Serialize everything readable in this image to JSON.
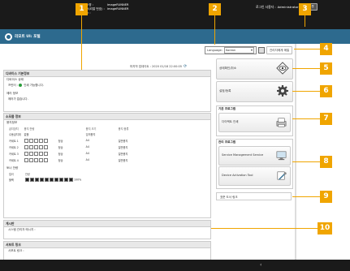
{
  "device_info": {
    "rows": [
      {
        "key": "디바이스명 :",
        "value": "imageRUNNER"
      },
      {
        "key": "제품명(시리얼 번호) :",
        "value": "imageRUNNER"
      },
      {
        "key": "설치장소 :",
        "value": ""
      }
    ]
  },
  "login": {
    "label": "로그인 사용자 :",
    "user": "Administrator",
    "logout": "로그아웃"
  },
  "app": {
    "title": "리모트 UI: 포털"
  },
  "language": {
    "label": "Language:",
    "selected": "Korean",
    "portal_button": "관리자에게 메일"
  },
  "last_updated": {
    "label": "마지막 업데이트 : 2020 01/18 22:00:05"
  },
  "device_status": {
    "header": "디바이스 기본정보",
    "device_state_title": "디바이스 상태",
    "device_state_text": "프린터 :",
    "device_state_value": "인쇄 가능합니다.",
    "error_title": "에러 정보",
    "error_text": "에러가 없습니다."
  },
  "consumables": {
    "header": "소모품 정보",
    "paper_title": "용지정보",
    "columns": [
      "급지장치",
      "용지 잔량",
      "용지 크기",
      "용지 종류"
    ],
    "rows": [
      {
        "source": "수동급지대",
        "level": "없음",
        "size": "임의용지",
        "type": "",
        "bars": 0
      },
      {
        "source": "카세트 1",
        "level": "정상",
        "size": "A4",
        "type": "일반용지",
        "bars": 4
      },
      {
        "source": "카세트 2",
        "level": "정상",
        "size": "A4",
        "type": "일반용지",
        "bars": 4
      },
      {
        "source": "카세트 3",
        "level": "정상",
        "size": "A4",
        "type": "일반용지",
        "bars": 4
      },
      {
        "source": "카세트 4",
        "level": "정상",
        "size": "A4",
        "type": "일반용지",
        "bars": 4
      }
    ],
    "toner_title": "토너 잔량",
    "toner_columns": [
      "컬러",
      "잔량"
    ],
    "toner_row": {
      "color": "블랙",
      "percent": "100%",
      "level": 1.0
    }
  },
  "nav_buttons": [
    {
      "label": "상태확인/취소",
      "icon": "eye-icon"
    },
    {
      "label": "설정/등록",
      "icon": "gear-icon"
    }
  ],
  "basic_program": {
    "header": "기본 프로그램",
    "item": "다이렉트 인쇄",
    "icon": "printer-icon"
  },
  "mgmt_program": {
    "header": "관리 프로그램",
    "items": [
      {
        "label": "Service Management Service",
        "icon": "monitor-icon"
      },
      {
        "label": "Device Activation Tool",
        "icon": "tools-icon"
      }
    ]
  },
  "support_link": {
    "label": "표준 도서 링크"
  },
  "messages": {
    "header": "게시판",
    "text": "시스템 관리자 메시지 :"
  },
  "support": {
    "header": "서포트 링크",
    "text": "서포트 링크 :"
  },
  "callouts": [
    "1",
    "2",
    "3",
    "4",
    "5",
    "6",
    "7",
    "8",
    "9",
    "10"
  ],
  "colors": {
    "callout": "#f0a500",
    "header_bg": "#1a1a1a",
    "titlebar": "#2d6a8e"
  }
}
